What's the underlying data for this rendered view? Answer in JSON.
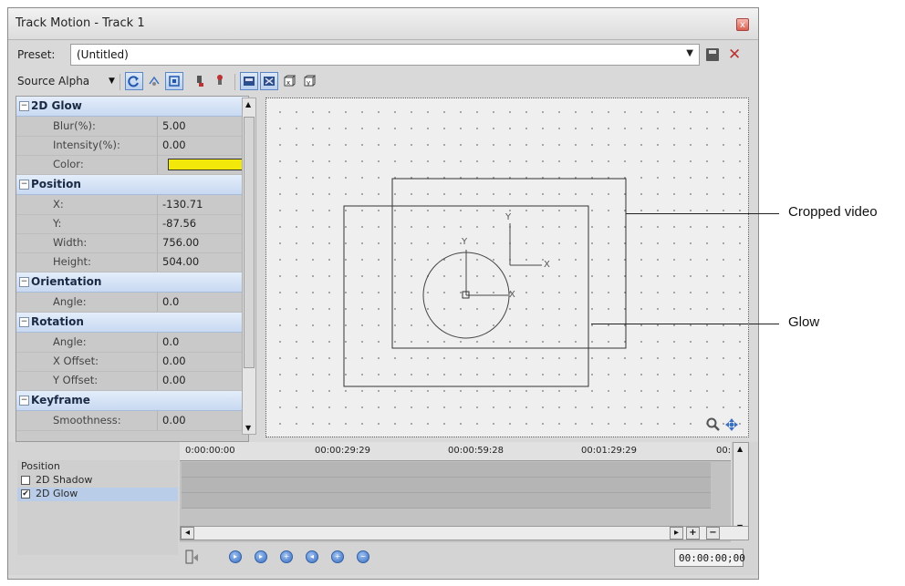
{
  "window": {
    "title": "Track Motion - Track 1",
    "close_glyph": "x"
  },
  "preset": {
    "label": "Preset:",
    "value": "(Untitled)"
  },
  "toolbar": {
    "source_label": "Source Alpha",
    "buttons": [
      "rotate-icon",
      "move-icon",
      "snap-to-grid-icon",
      "camera-icon",
      "lock-icon",
      "edit-in-object-space-icon",
      "prevent-movement-icon",
      "cube-x-icon",
      "cube-y-icon"
    ]
  },
  "properties": {
    "sections": [
      {
        "name": "2D Glow",
        "rows": [
          {
            "label": "Blur(%):",
            "value": "5.00"
          },
          {
            "label": "Intensity(%):",
            "value": "0.00"
          },
          {
            "label": "Color:",
            "value": ""
          }
        ]
      },
      {
        "name": "Position",
        "rows": [
          {
            "label": "X:",
            "value": "-130.71"
          },
          {
            "label": "Y:",
            "value": "-87.56"
          },
          {
            "label": "Width:",
            "value": "756.00"
          },
          {
            "label": "Height:",
            "value": "504.00"
          }
        ]
      },
      {
        "name": "Orientation",
        "rows": [
          {
            "label": "Angle:",
            "value": "0.0"
          }
        ]
      },
      {
        "name": "Rotation",
        "rows": [
          {
            "label": "Angle:",
            "value": "0.0"
          },
          {
            "label": "X Offset:",
            "value": "0.00"
          },
          {
            "label": "Y Offset:",
            "value": "0.00"
          }
        ]
      },
      {
        "name": "Keyframe",
        "rows": [
          {
            "label": "Smoothness:",
            "value": "0.00"
          }
        ]
      }
    ],
    "glow_color": "#f2e80a"
  },
  "canvas": {
    "axis_y": "Y",
    "axis_x": "X"
  },
  "callouts": {
    "cropped": "Cropped video",
    "glow": "Glow"
  },
  "timeline": {
    "ruler": [
      "0:00:00:00",
      "00:00:29:29",
      "00:00:59:28",
      "00:01:29:29",
      "00:"
    ],
    "tracks": [
      {
        "label": "Position",
        "checked": null
      },
      {
        "label": "2D Shadow",
        "checked": false
      },
      {
        "label": "2D Glow",
        "checked": true
      }
    ],
    "time_display": "00:00:00;00"
  }
}
